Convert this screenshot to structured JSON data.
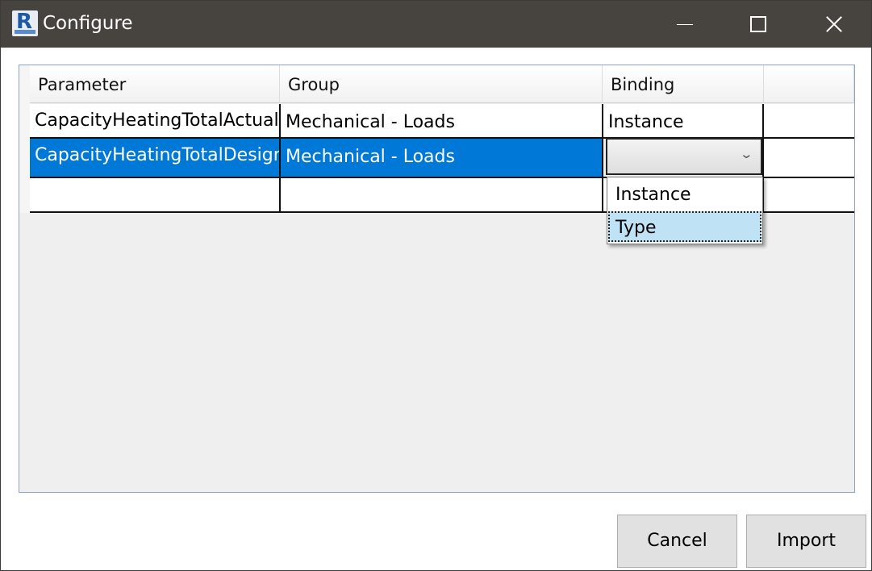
{
  "window": {
    "title": "Configure",
    "app_icon_letter": "R"
  },
  "grid": {
    "columns": [
      "Parameter",
      "Group",
      "Binding"
    ],
    "rows": [
      {
        "parameter": "CapacityHeatingTotalActual",
        "group": "Mechanical - Loads",
        "binding": "Instance",
        "selected": false
      },
      {
        "parameter": "CapacityHeatingTotalDesign",
        "group": "Mechanical - Loads",
        "binding": "",
        "selected": true
      },
      {
        "parameter": "",
        "group": "",
        "binding": "",
        "selected": false
      }
    ],
    "binding_options": [
      "Instance",
      "Type"
    ],
    "highlighted_option": "Type",
    "selection_color": "#0078d7"
  },
  "buttons": {
    "cancel": "Cancel",
    "import": "Import"
  }
}
